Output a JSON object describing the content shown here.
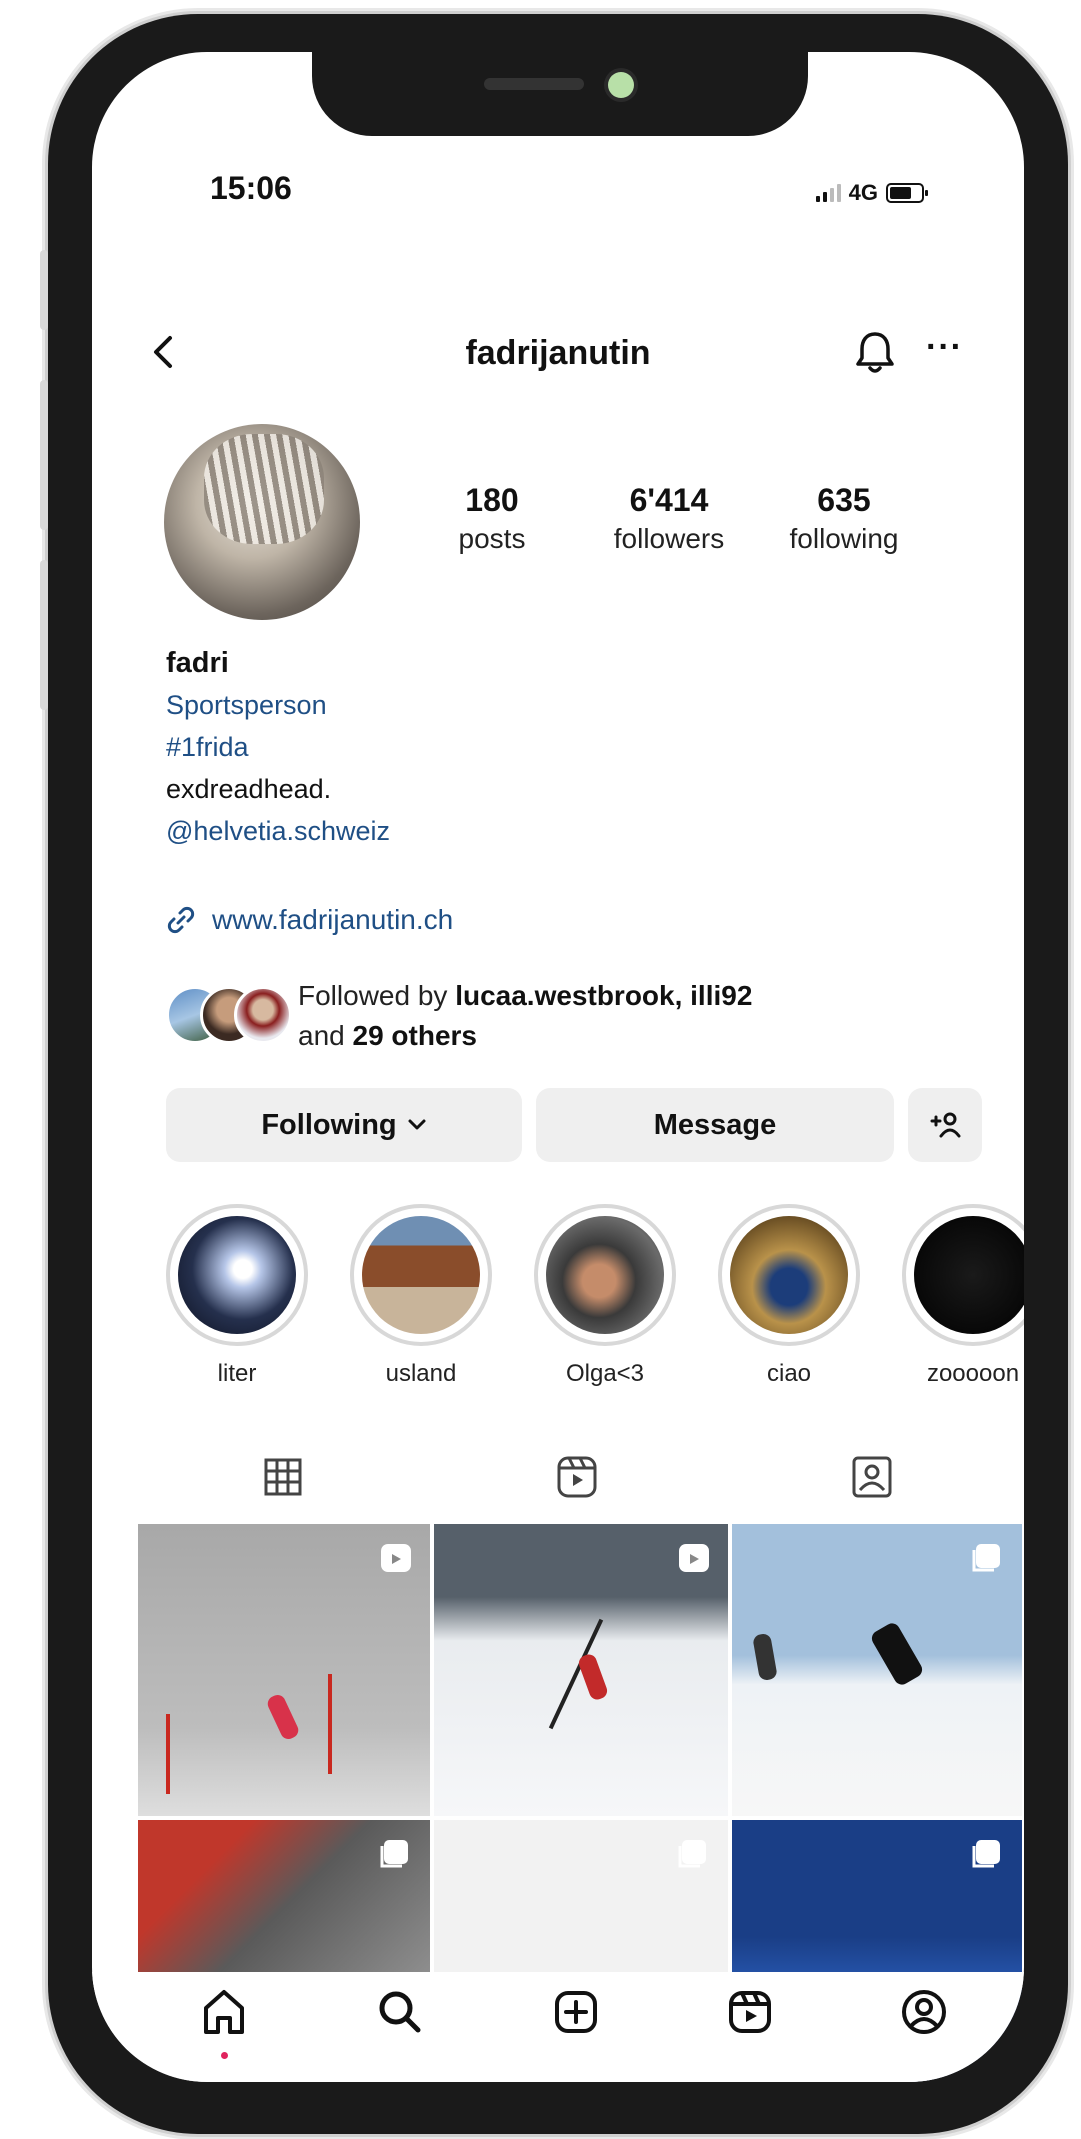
{
  "status_bar": {
    "time": "15:06",
    "network": "4G"
  },
  "header": {
    "username": "fadrijanutin"
  },
  "profile": {
    "stats": [
      {
        "value": "180",
        "label": "posts"
      },
      {
        "value": "6'414",
        "label": "followers"
      },
      {
        "value": "635",
        "label": "following"
      }
    ],
    "name": "fadri",
    "category": "Sportsperson",
    "hashtag": "#1frida",
    "bio": "exdreadhead.",
    "mention": "@helvetia.schweiz",
    "website": "www.fadrijanutin.ch",
    "followed_by": {
      "prefix": "Followed by ",
      "names": "lucaa.westbrook, illi92",
      "and": "and ",
      "others": "29 others"
    }
  },
  "actions": {
    "following_label": "Following",
    "message_label": "Message",
    "add_icon": "+ஃ"
  },
  "highlights": [
    {
      "label": "liter"
    },
    {
      "label": "usland"
    },
    {
      "label": "Olga<3"
    },
    {
      "label": "ciao"
    },
    {
      "label": "zooooon"
    }
  ],
  "tabs": [
    {
      "name": "grid-icon"
    },
    {
      "name": "reels-icon"
    },
    {
      "name": "tagged-icon"
    }
  ],
  "posts": [
    {
      "type": "reel"
    },
    {
      "type": "reel"
    },
    {
      "type": "carousel"
    },
    {
      "type": "carousel"
    },
    {
      "type": "carousel"
    },
    {
      "type": "carousel"
    }
  ],
  "bottom_nav": [
    "home-icon",
    "search-icon",
    "create-icon",
    "reels-icon",
    "profile-icon"
  ],
  "colors": {
    "link_blue": "#1f4f85",
    "button_bg": "#efefef",
    "notification_dot": "#e0245e"
  }
}
